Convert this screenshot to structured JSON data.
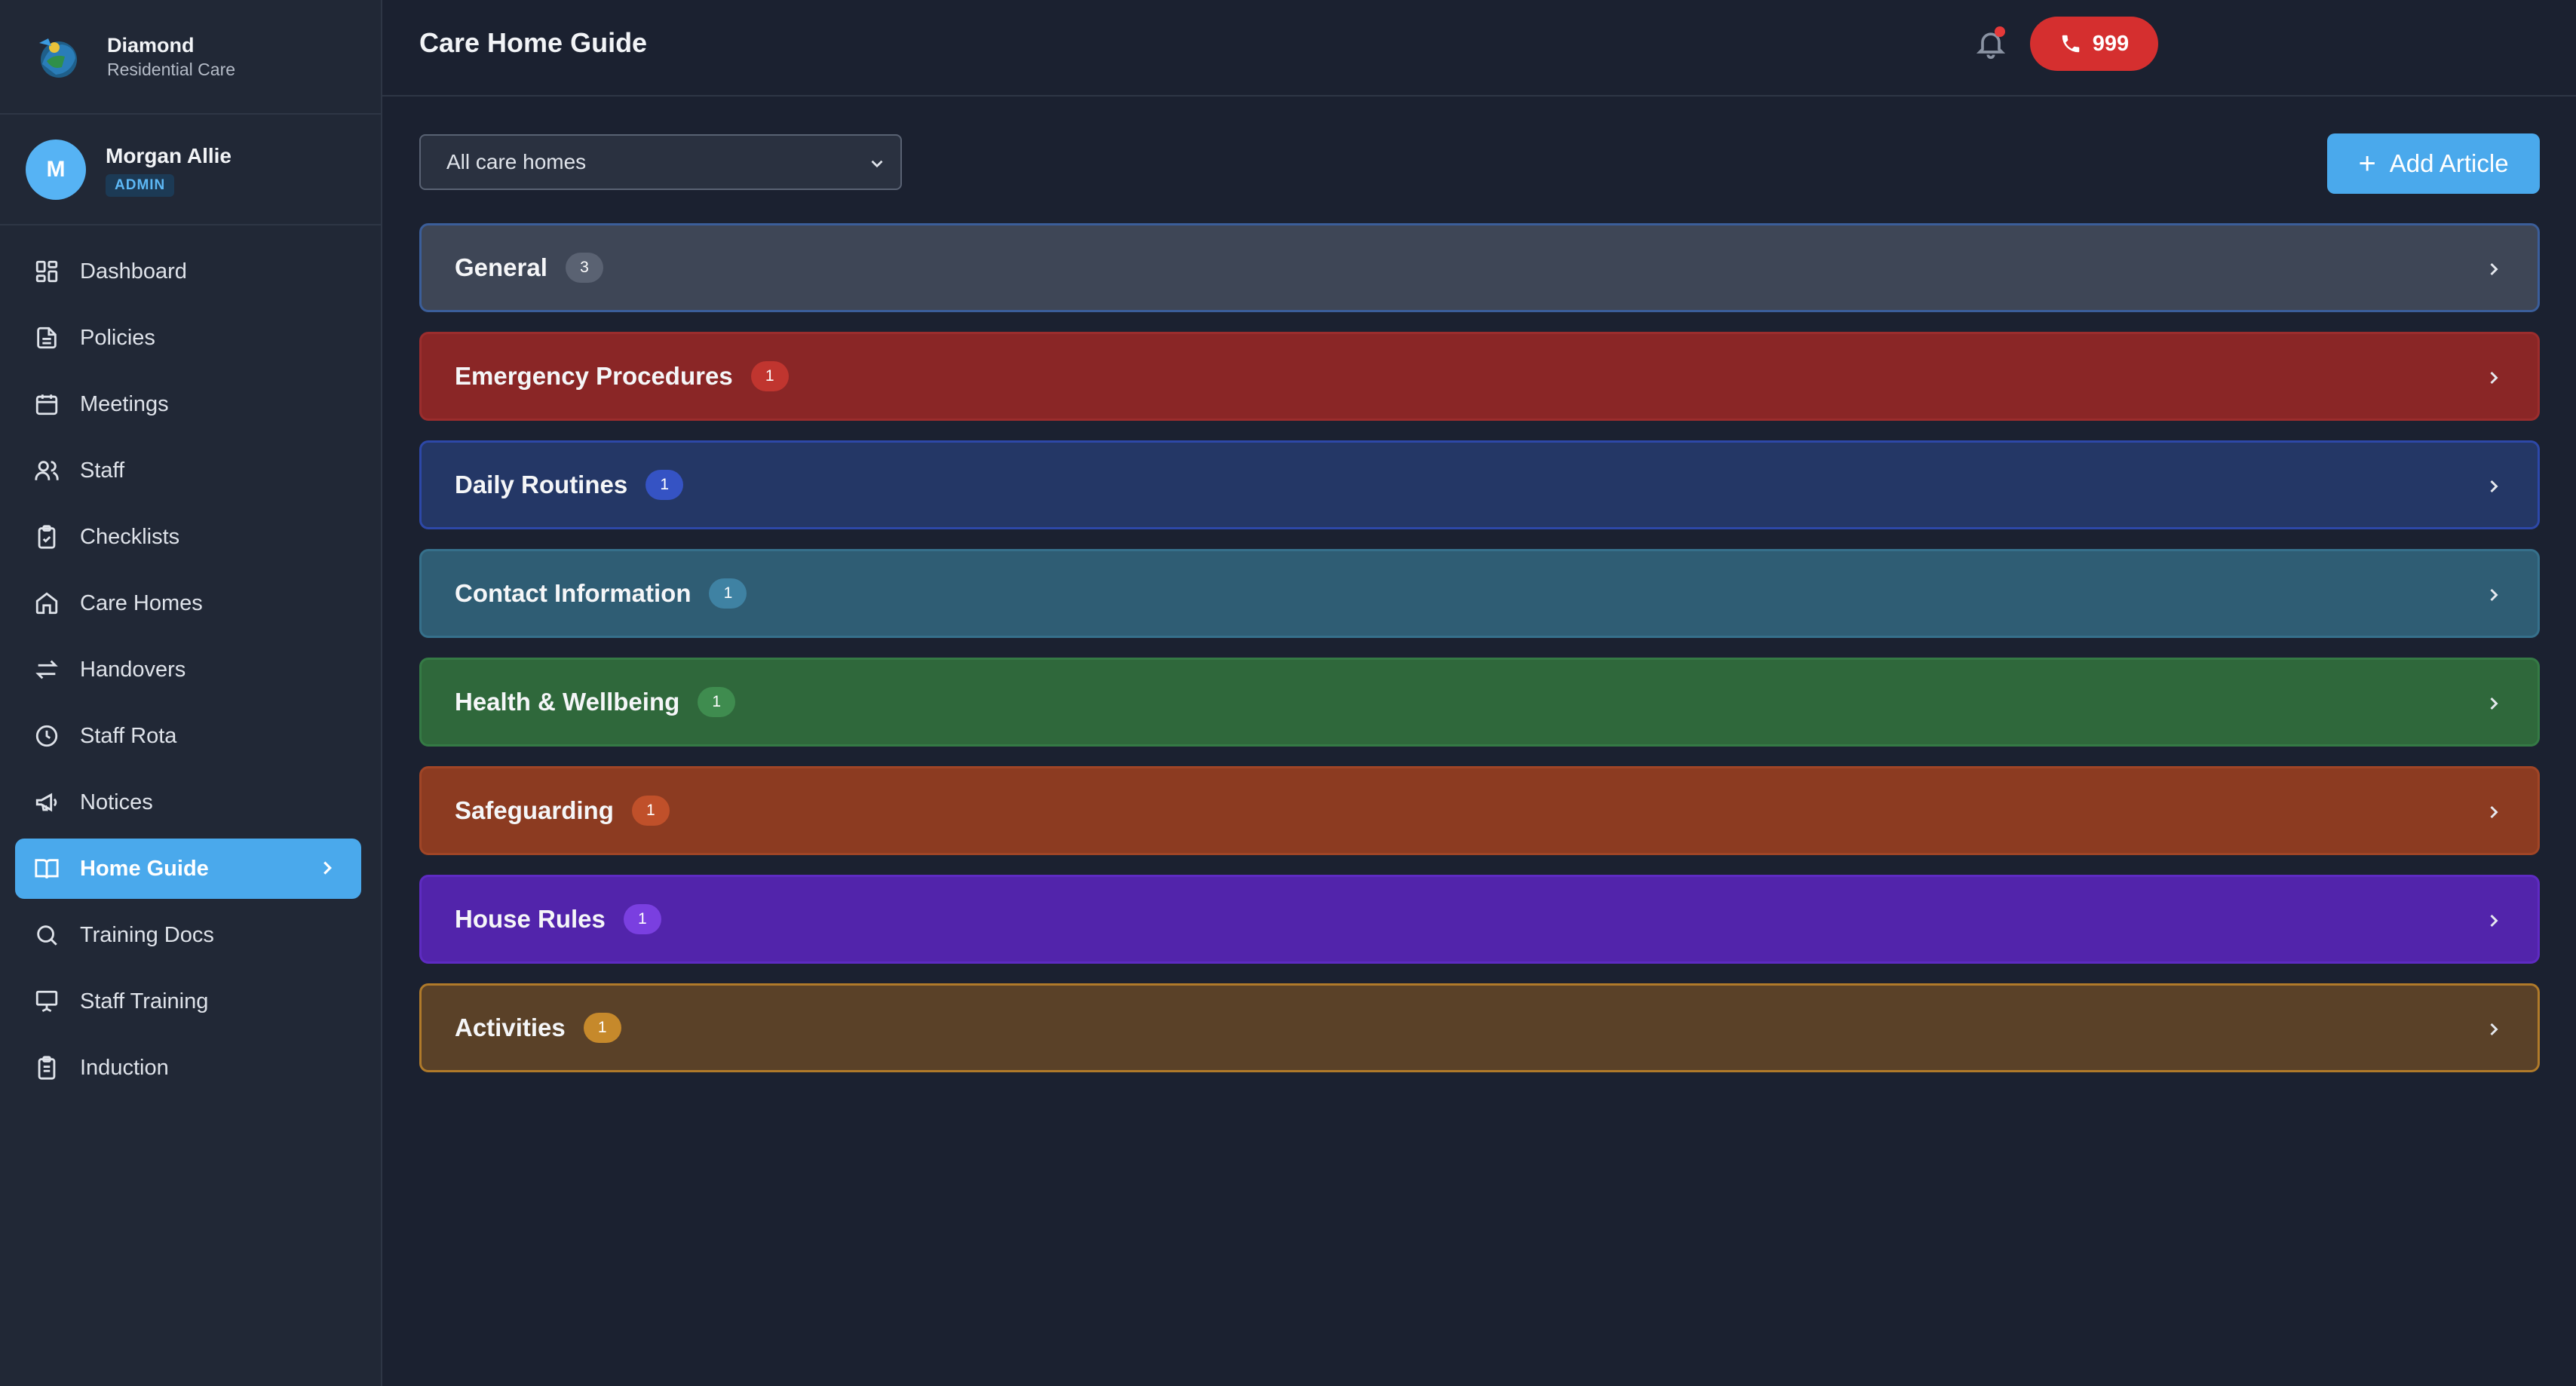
{
  "brand": {
    "name": "Diamond",
    "subtitle": "Residential Care"
  },
  "user": {
    "initial": "M",
    "name": "Morgan Allie",
    "role": "ADMIN"
  },
  "nav": [
    {
      "label": "Dashboard",
      "icon": "dashboard-icon"
    },
    {
      "label": "Policies",
      "icon": "document-icon"
    },
    {
      "label": "Meetings",
      "icon": "calendar-icon"
    },
    {
      "label": "Staff",
      "icon": "users-icon"
    },
    {
      "label": "Checklists",
      "icon": "clipboard-check-icon"
    },
    {
      "label": "Care Homes",
      "icon": "home-icon"
    },
    {
      "label": "Handovers",
      "icon": "swap-arrows-icon"
    },
    {
      "label": "Staff Rota",
      "icon": "clock-icon"
    },
    {
      "label": "Notices",
      "icon": "megaphone-icon"
    },
    {
      "label": "Home Guide",
      "icon": "book-open-icon",
      "active": true
    },
    {
      "label": "Training Docs",
      "icon": "search-icon"
    },
    {
      "label": "Staff Training",
      "icon": "presentation-icon"
    },
    {
      "label": "Induction",
      "icon": "clipboard-list-icon"
    }
  ],
  "header": {
    "title": "Care Home Guide",
    "emergency_label": "999"
  },
  "filter": {
    "selected": "All care homes"
  },
  "add_button": {
    "label": "Add Article"
  },
  "categories": [
    {
      "label": "General",
      "count": "3",
      "bg": "#3e4656",
      "border": "#3b5e9a",
      "badge": "#5a6272"
    },
    {
      "label": "Emergency Procedures",
      "count": "1",
      "bg": "#8a2626",
      "border": "#9b2d2d",
      "badge": "#c0352f"
    },
    {
      "label": "Daily Routines",
      "count": "1",
      "bg": "#243766",
      "border": "#2d48a8",
      "badge": "#3553c4"
    },
    {
      "label": "Contact Information",
      "count": "1",
      "bg": "#2f5d74",
      "border": "#36708b",
      "badge": "#3f82a3"
    },
    {
      "label": "Health & Wellbeing",
      "count": "1",
      "bg": "#2f683b",
      "border": "#357a45",
      "badge": "#3f8c4f"
    },
    {
      "label": "Safeguarding",
      "count": "1",
      "bg": "#8c3b21",
      "border": "#a04526",
      "badge": "#c0502a"
    },
    {
      "label": "House Rules",
      "count": "1",
      "bg": "#5224ab",
      "border": "#5e2bc2",
      "badge": "#7a3fe0"
    },
    {
      "label": "Activities",
      "count": "1",
      "bg": "#5a4128",
      "border": "#b07a2a",
      "badge": "#c6892b"
    }
  ],
  "colors": {
    "accent": "#4aa9ec",
    "emergency": "#d52f2f",
    "background": "#1b2130",
    "sidebar": "#212836"
  }
}
